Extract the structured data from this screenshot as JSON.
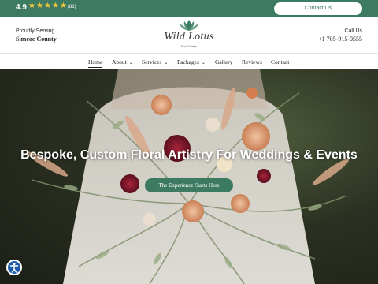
{
  "topbar": {
    "rating": "4.9",
    "stars_filled": 5,
    "stars_total": 5,
    "review_count": "(81)",
    "contact_label": "Contact Us"
  },
  "header": {
    "serving_label": "Proudly Serving",
    "serving_region": "Simcoe County",
    "logo_name": "Wild Lotus",
    "logo_tagline": "Floral Design",
    "call_label": "Call Us",
    "phone": "+1 705-915-0555"
  },
  "nav": {
    "items": [
      {
        "label": "Home",
        "active": true,
        "dropdown": false
      },
      {
        "label": "About",
        "active": false,
        "dropdown": true
      },
      {
        "label": "Services",
        "active": false,
        "dropdown": true
      },
      {
        "label": "Packages",
        "active": false,
        "dropdown": true
      },
      {
        "label": "Gallery",
        "active": false,
        "dropdown": false
      },
      {
        "label": "Reviews",
        "active": false,
        "dropdown": false
      },
      {
        "label": "Contact",
        "active": false,
        "dropdown": false
      }
    ]
  },
  "hero": {
    "title": "Bespoke, Custom Floral Artistry For Weddings & Events",
    "cta_label": "The Experience Starts Here"
  },
  "colors": {
    "brand_green": "#3d7a62",
    "star_gold": "#f3c53b",
    "accessibility_blue": "#1f5aa8"
  },
  "icons": {
    "stars": "star-icon",
    "caret": "chevron-down-icon",
    "accessibility": "accessibility-icon",
    "logo": "lotus-icon"
  }
}
